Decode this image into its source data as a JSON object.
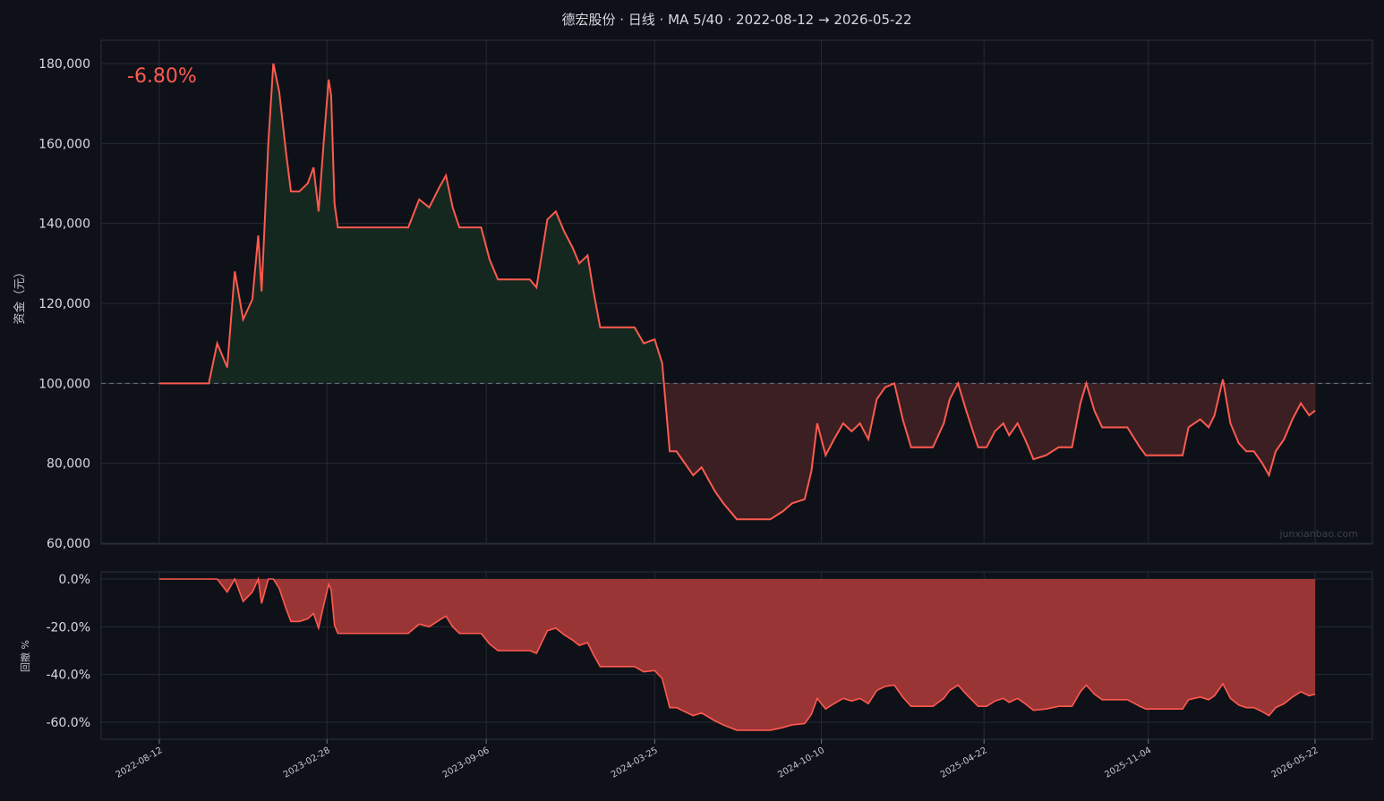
{
  "title": "德宏股份 · 日线 · MA 5/40 · 2022-08-12 → 2026-05-22",
  "return_label": "-6.80%",
  "watermark": "junxianbao.com",
  "colors": {
    "background": "#0e1118",
    "line": "#ff5a4f",
    "gain_fill": "#15281f",
    "loss_fill": "#3c1f22",
    "drawdown_fill": "#9a3535",
    "grid": "#262a33"
  },
  "chart_data": [
    {
      "type": "area",
      "ylabel": "资金（元）",
      "ylim": [
        60000,
        180000
      ],
      "yticks": [
        60000,
        80000,
        100000,
        120000,
        140000,
        160000,
        180000
      ],
      "ytick_labels": [
        "60,000",
        "80,000",
        "100,000",
        "120,000",
        "140,000",
        "160,000",
        "180,000"
      ],
      "baseline": 100000,
      "grid": true,
      "series": [
        {
          "x": [
            "2022-08-12",
            "2022-10-10",
            "2022-10-20",
            "2022-11-01",
            "2022-11-10",
            "2022-11-20",
            "2022-12-01",
            "2022-12-08",
            "2022-12-12",
            "2022-12-20",
            "2022-12-26",
            "2023-01-02",
            "2023-01-10",
            "2023-01-16",
            "2023-01-26",
            "2023-02-05",
            "2023-02-12",
            "2023-02-18",
            "2023-02-24",
            "2023-03-02",
            "2023-03-05",
            "2023-03-09",
            "2023-03-13",
            "2023-03-18",
            "2023-04-01",
            "2023-05-01",
            "2023-06-01",
            "2023-06-05",
            "2023-06-18",
            "2023-06-30",
            "2023-07-12",
            "2023-07-20",
            "2023-07-28",
            "2023-08-05",
            "2023-08-20",
            "2023-08-31",
            "2023-09-10",
            "2023-09-20",
            "2023-10-20",
            "2023-10-28",
            "2023-11-05",
            "2023-11-18",
            "2023-11-28",
            "2023-12-08",
            "2023-12-18",
            "2023-12-26",
            "2024-01-05",
            "2024-01-12",
            "2024-01-20",
            "2024-02-01",
            "2024-02-15",
            "2024-03-01",
            "2024-03-12",
            "2024-03-25",
            "2024-04-03",
            "2024-04-12",
            "2024-04-20",
            "2024-05-10",
            "2024-05-20",
            "2024-06-05",
            "2024-06-15",
            "2024-07-01",
            "2024-07-20",
            "2024-08-10",
            "2024-08-25",
            "2024-09-05",
            "2024-09-20",
            "2024-09-28",
            "2024-10-05",
            "2024-10-15",
            "2024-10-25",
            "2024-11-05",
            "2024-11-15",
            "2024-11-25",
            "2024-12-05",
            "2024-12-15",
            "2024-12-25",
            "2025-01-05",
            "2025-01-15",
            "2025-01-25",
            "2025-02-05",
            "2025-02-20",
            "2025-03-05",
            "2025-03-12",
            "2025-03-22",
            "2025-04-01",
            "2025-04-15",
            "2025-04-25",
            "2025-05-05",
            "2025-05-15",
            "2025-05-22",
            "2025-06-01",
            "2025-06-10",
            "2025-06-20",
            "2025-07-05",
            "2025-07-20",
            "2025-08-05",
            "2025-08-15",
            "2025-08-22",
            "2025-09-01",
            "2025-09-10",
            "2025-09-20",
            "2025-10-01",
            "2025-10-10",
            "2025-10-25",
            "2025-11-01",
            "2025-11-10",
            "2025-12-01",
            "2025-12-15",
            "2025-12-22",
            "2026-01-05",
            "2026-01-15",
            "2026-01-22",
            "2026-02-01",
            "2026-02-10",
            "2026-02-20",
            "2026-03-01",
            "2026-03-10",
            "2026-03-20",
            "2026-03-28",
            "2026-04-05",
            "2026-04-15",
            "2026-04-25",
            "2026-05-05",
            "2026-05-15",
            "2026-05-22"
          ],
          "y": [
            100000,
            100000,
            110000,
            104000,
            128000,
            116000,
            121000,
            137000,
            123000,
            160000,
            180000,
            173000,
            158000,
            148000,
            148000,
            150000,
            154000,
            143000,
            160000,
            176000,
            172000,
            145000,
            139000,
            139000,
            139000,
            139000,
            139000,
            139000,
            146000,
            144000,
            149000,
            152000,
            144000,
            139000,
            139000,
            139000,
            131000,
            126000,
            126000,
            126000,
            124000,
            141000,
            143000,
            138000,
            134000,
            130000,
            132000,
            123000,
            114000,
            114000,
            114000,
            114000,
            110000,
            111000,
            105000,
            83000,
            83000,
            77000,
            79000,
            73000,
            70000,
            66000,
            66000,
            66000,
            68000,
            70000,
            71000,
            78000,
            90000,
            82000,
            86000,
            90000,
            88000,
            90000,
            86000,
            96000,
            99000,
            100000,
            91000,
            84000,
            84000,
            84000,
            90000,
            96000,
            100000,
            93000,
            84000,
            84000,
            88000,
            90000,
            87000,
            90000,
            86000,
            81000,
            82000,
            84000,
            84000,
            95000,
            100000,
            93000,
            89000,
            89000,
            89000,
            89000,
            84000,
            82000,
            82000,
            82000,
            82000,
            89000,
            91000,
            89000,
            92000,
            101000,
            90000,
            85000,
            83000,
            83000,
            80000,
            77000,
            83000,
            86000,
            91000,
            95000,
            92000,
            93200
          ]
        }
      ]
    },
    {
      "type": "area",
      "ylabel": "回撤 %",
      "ylim": [
        -66,
        2
      ],
      "yticks": [
        0,
        -20,
        -40,
        -60
      ],
      "ytick_labels": [
        "0.0%",
        "-20.0%",
        "-40.0%",
        "-60.0%"
      ],
      "grid": true,
      "x_tick_labels": [
        "2022-08-12",
        "2023-02-28",
        "2023-09-06",
        "2024-03-25",
        "2024-10-10",
        "2025-04-22",
        "2025-11-04",
        "2026-05-22"
      ]
    }
  ]
}
